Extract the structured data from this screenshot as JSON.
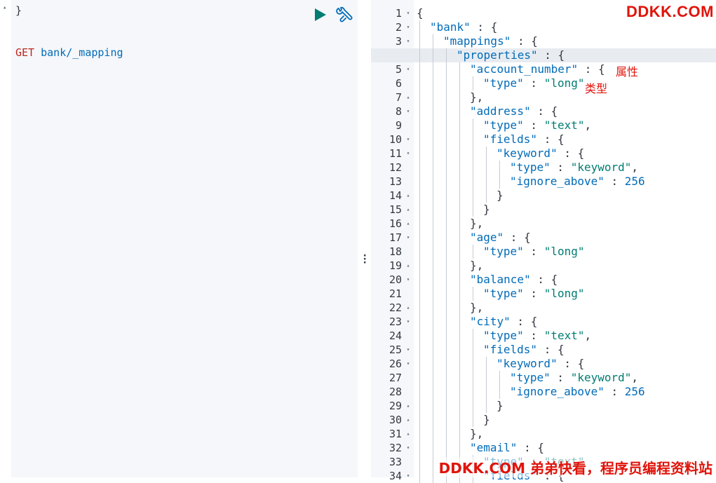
{
  "request": {
    "prev_brace": "}",
    "verb": "GET",
    "path": "bank/_mapping"
  },
  "icons": {
    "run": "play-icon",
    "settings": "wrench-icon",
    "splitter": "vertical-dots-icon"
  },
  "colors": {
    "key": "#006bb8",
    "string": "#017d73",
    "verb": "#bd271e",
    "annotation": "#e0140b",
    "run_button": "#017d73"
  },
  "response": {
    "lines": [
      {
        "n": "1",
        "fold": "▾",
        "indent": 0,
        "parts": [
          [
            "punc",
            "{"
          ]
        ]
      },
      {
        "n": "2",
        "fold": "▾",
        "indent": 1,
        "parts": [
          [
            "key",
            "\"bank\""
          ],
          [
            "punc",
            " : {"
          ]
        ]
      },
      {
        "n": "3",
        "fold": "▾",
        "indent": 2,
        "parts": [
          [
            "key",
            "\"mappings\""
          ],
          [
            "punc",
            " : {"
          ]
        ]
      },
      {
        "n": "4",
        "fold": "▾",
        "indent": 3,
        "parts": [
          [
            "key",
            "\"properties\""
          ],
          [
            "punc",
            " : {"
          ]
        ]
      },
      {
        "n": "5",
        "fold": "▾",
        "indent": 4,
        "parts": [
          [
            "key",
            "\"account_number\""
          ],
          [
            "punc",
            " : {"
          ]
        ]
      },
      {
        "n": "6",
        "fold": "",
        "indent": 5,
        "parts": [
          [
            "key",
            "\"type\""
          ],
          [
            "punc",
            " : "
          ],
          [
            "str",
            "\"long\""
          ]
        ]
      },
      {
        "n": "7",
        "fold": "▴",
        "indent": 4,
        "parts": [
          [
            "punc",
            "},"
          ]
        ]
      },
      {
        "n": "8",
        "fold": "▾",
        "indent": 4,
        "parts": [
          [
            "key",
            "\"address\""
          ],
          [
            "punc",
            " : {"
          ]
        ]
      },
      {
        "n": "9",
        "fold": "",
        "indent": 5,
        "parts": [
          [
            "key",
            "\"type\""
          ],
          [
            "punc",
            " : "
          ],
          [
            "str",
            "\"text\""
          ],
          [
            "punc",
            ","
          ]
        ]
      },
      {
        "n": "10",
        "fold": "▾",
        "indent": 5,
        "parts": [
          [
            "key",
            "\"fields\""
          ],
          [
            "punc",
            " : {"
          ]
        ]
      },
      {
        "n": "11",
        "fold": "▾",
        "indent": 6,
        "parts": [
          [
            "key",
            "\"keyword\""
          ],
          [
            "punc",
            " : {"
          ]
        ]
      },
      {
        "n": "12",
        "fold": "",
        "indent": 7,
        "parts": [
          [
            "key",
            "\"type\""
          ],
          [
            "punc",
            " : "
          ],
          [
            "str",
            "\"keyword\""
          ],
          [
            "punc",
            ","
          ]
        ]
      },
      {
        "n": "13",
        "fold": "",
        "indent": 7,
        "parts": [
          [
            "key",
            "\"ignore_above\""
          ],
          [
            "punc",
            " : "
          ],
          [
            "num",
            "256"
          ]
        ]
      },
      {
        "n": "14",
        "fold": "▴",
        "indent": 6,
        "parts": [
          [
            "punc",
            "}"
          ]
        ]
      },
      {
        "n": "15",
        "fold": "▴",
        "indent": 5,
        "parts": [
          [
            "punc",
            "}"
          ]
        ]
      },
      {
        "n": "16",
        "fold": "▴",
        "indent": 4,
        "parts": [
          [
            "punc",
            "},"
          ]
        ]
      },
      {
        "n": "17",
        "fold": "▾",
        "indent": 4,
        "parts": [
          [
            "key",
            "\"age\""
          ],
          [
            "punc",
            " : {"
          ]
        ]
      },
      {
        "n": "18",
        "fold": "",
        "indent": 5,
        "parts": [
          [
            "key",
            "\"type\""
          ],
          [
            "punc",
            " : "
          ],
          [
            "str",
            "\"long\""
          ]
        ]
      },
      {
        "n": "19",
        "fold": "▴",
        "indent": 4,
        "parts": [
          [
            "punc",
            "},"
          ]
        ]
      },
      {
        "n": "20",
        "fold": "▾",
        "indent": 4,
        "parts": [
          [
            "key",
            "\"balance\""
          ],
          [
            "punc",
            " : {"
          ]
        ]
      },
      {
        "n": "21",
        "fold": "",
        "indent": 5,
        "parts": [
          [
            "key",
            "\"type\""
          ],
          [
            "punc",
            " : "
          ],
          [
            "str",
            "\"long\""
          ]
        ]
      },
      {
        "n": "22",
        "fold": "▴",
        "indent": 4,
        "parts": [
          [
            "punc",
            "},"
          ]
        ]
      },
      {
        "n": "23",
        "fold": "▾",
        "indent": 4,
        "parts": [
          [
            "key",
            "\"city\""
          ],
          [
            "punc",
            " : {"
          ]
        ]
      },
      {
        "n": "24",
        "fold": "",
        "indent": 5,
        "parts": [
          [
            "key",
            "\"type\""
          ],
          [
            "punc",
            " : "
          ],
          [
            "str",
            "\"text\""
          ],
          [
            "punc",
            ","
          ]
        ]
      },
      {
        "n": "25",
        "fold": "▾",
        "indent": 5,
        "parts": [
          [
            "key",
            "\"fields\""
          ],
          [
            "punc",
            " : {"
          ]
        ]
      },
      {
        "n": "26",
        "fold": "▾",
        "indent": 6,
        "parts": [
          [
            "key",
            "\"keyword\""
          ],
          [
            "punc",
            " : {"
          ]
        ]
      },
      {
        "n": "27",
        "fold": "",
        "indent": 7,
        "parts": [
          [
            "key",
            "\"type\""
          ],
          [
            "punc",
            " : "
          ],
          [
            "str",
            "\"keyword\""
          ],
          [
            "punc",
            ","
          ]
        ]
      },
      {
        "n": "28",
        "fold": "",
        "indent": 7,
        "parts": [
          [
            "key",
            "\"ignore_above\""
          ],
          [
            "punc",
            " : "
          ],
          [
            "num",
            "256"
          ]
        ]
      },
      {
        "n": "29",
        "fold": "▴",
        "indent": 6,
        "parts": [
          [
            "punc",
            "}"
          ]
        ]
      },
      {
        "n": "30",
        "fold": "▴",
        "indent": 5,
        "parts": [
          [
            "punc",
            "}"
          ]
        ]
      },
      {
        "n": "31",
        "fold": "▴",
        "indent": 4,
        "parts": [
          [
            "punc",
            "},"
          ]
        ]
      },
      {
        "n": "32",
        "fold": "▾",
        "indent": 4,
        "parts": [
          [
            "key",
            "\"email\""
          ],
          [
            "punc",
            " : {"
          ]
        ]
      },
      {
        "n": "33",
        "fold": "",
        "indent": 5,
        "parts": [
          [
            "key",
            "\"type\""
          ],
          [
            "punc",
            " : "
          ],
          [
            "str",
            "\"text\""
          ]
        ]
      },
      {
        "n": "34",
        "fold": "▾",
        "indent": 5,
        "parts": [
          [
            "key",
            "\"fields\""
          ],
          [
            "punc",
            " : {"
          ]
        ]
      }
    ]
  },
  "annotations": {
    "property_label": "属性",
    "type_label": "类型"
  },
  "watermarks": {
    "top": "DDKK.COM",
    "bottom": "DDKK.COM 弟弟快看，程序员编程资料站"
  }
}
